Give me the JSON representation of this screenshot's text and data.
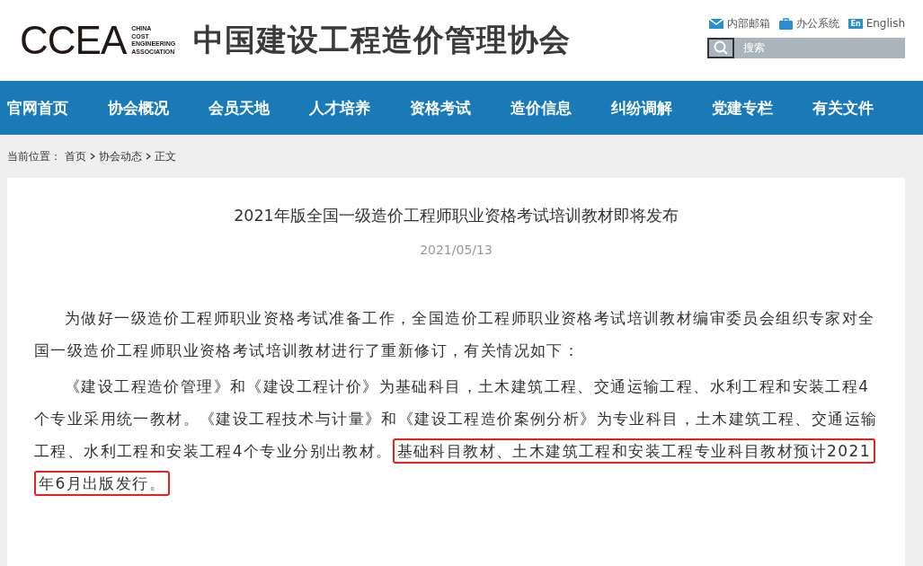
{
  "logo": {
    "mark": "CCEA",
    "lines": [
      "CHINA",
      "COST",
      "ENGINEERING",
      "ASSOCIATION"
    ]
  },
  "site_title": "中国建设工程造价管理协会",
  "top_links": [
    {
      "kind": "mail",
      "label": "内部邮箱"
    },
    {
      "kind": "case",
      "label": "办公系统"
    },
    {
      "kind": "lang",
      "badge": "En",
      "label": "English"
    }
  ],
  "search": {
    "placeholder": "搜索"
  },
  "nav": [
    "官网首页",
    "协会概况",
    "会员天地",
    "人才培养",
    "资格考试",
    "造价信息",
    "纠纷调解",
    "党建专栏",
    "有关文件"
  ],
  "breadcrumb": {
    "prefix": "当前位置：",
    "items": [
      "首页",
      "协会动态",
      "正文"
    ]
  },
  "article": {
    "title": "2021年版全国一级造价工程师职业资格考试培训教材即将发布",
    "date": "2021/05/13",
    "paragraphs": [
      [
        {
          "text": "为做好一级造价工程师职业资格考试准备工作，全国造价工程师职业资格考试培训教材编审委员会组织专家对全国一级造价工程师职业资格考试培训教材进行了重新修订，有关情况如下：",
          "highlighted": false
        }
      ],
      [
        {
          "text": "《建设工程造价管理》和《建设工程计价》为基础科目，土木建筑工程、交通运输工程、水利工程和安装工程4个专业采用统一教材。《建设工程技术与计量》和《建设工程造价案例分析》为专业科目，土木建筑工程、交通运输工程、水利工程和安装工程4个专业分别出教材。",
          "highlighted": false
        },
        {
          "text": "基础科目教材、土木建筑工程和安装工程专业科目教材预计2021年6月出版发行。",
          "highlighted": true
        }
      ]
    ]
  }
}
